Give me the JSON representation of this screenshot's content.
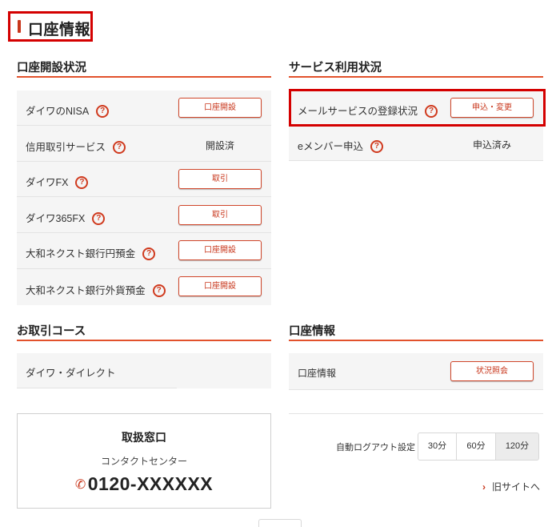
{
  "page": {
    "title": "口座情報"
  },
  "account_status": {
    "heading": "口座開設状況",
    "rows": [
      {
        "label": "ダイワのNISA",
        "action": "口座開設"
      },
      {
        "label": "信用取引サービス",
        "status": "開設済"
      },
      {
        "label": "ダイワFX",
        "action": "取引"
      },
      {
        "label": "ダイワ365FX",
        "action": "取引"
      },
      {
        "label": "大和ネクスト銀行円預金",
        "action": "口座開設"
      },
      {
        "label": "大和ネクスト銀行外貨預金",
        "action": "口座開設"
      }
    ]
  },
  "service_status": {
    "heading": "サービス利用状況",
    "rows": [
      {
        "label": "メールサービスの登録状況",
        "action": "申込・変更"
      },
      {
        "label": "eメンバー申込",
        "status": "申込済み"
      }
    ]
  },
  "course": {
    "heading": "お取引コース",
    "value": "ダイワ・ダイレクト"
  },
  "account_info": {
    "heading": "口座情報",
    "label": "口座情報",
    "action": "状況照会"
  },
  "contact": {
    "title": "取扱窓口",
    "subtitle": "コンタクトセンター",
    "phone": "0120-XXXXXX"
  },
  "logout": {
    "label": "自動ログアウト設定",
    "options": [
      "30分",
      "60分",
      "120分"
    ],
    "selected": "120分"
  },
  "old_site": {
    "label": "旧サイトへ"
  },
  "help_symbol": "?",
  "colors": {
    "accent": "#c8361b",
    "highlight": "#d40000",
    "row_bg": "#f5f5f5"
  }
}
